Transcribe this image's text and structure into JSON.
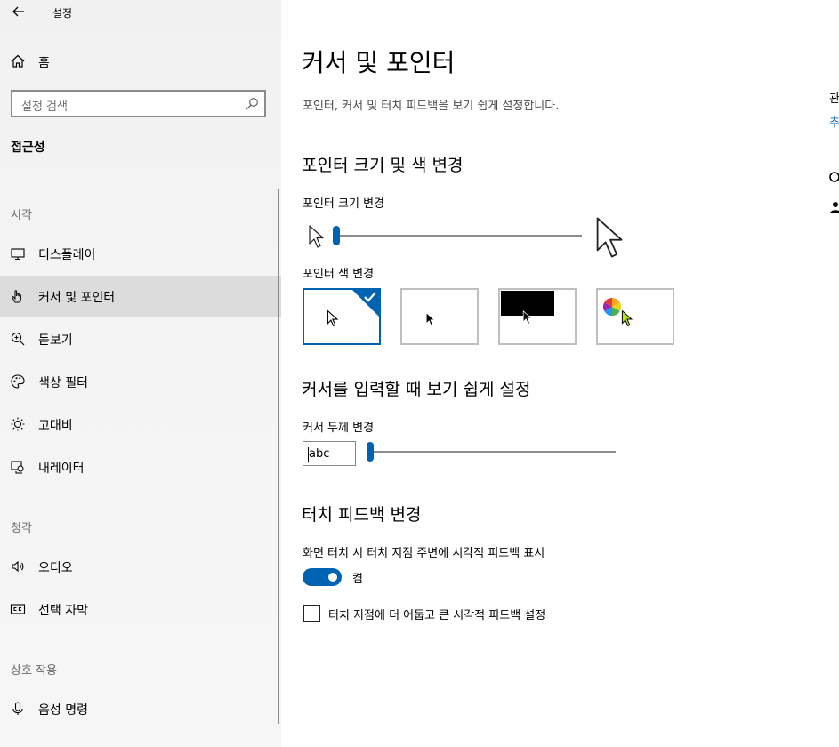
{
  "window": {
    "title": "설정"
  },
  "sidebar": {
    "home_label": "홈",
    "search_placeholder": "설정 검색",
    "section_title": "접근성",
    "groups": [
      {
        "label": "시각",
        "items": [
          {
            "label": "디스플레이",
            "icon": "monitor-icon"
          },
          {
            "label": "커서 및 포인터",
            "icon": "pointer-hand-icon",
            "selected": true
          },
          {
            "label": "돋보기",
            "icon": "magnifier-icon"
          },
          {
            "label": "색상 필터",
            "icon": "palette-icon"
          },
          {
            "label": "고대비",
            "icon": "brightness-icon"
          },
          {
            "label": "내레이터",
            "icon": "narrator-icon"
          }
        ]
      },
      {
        "label": "청각",
        "items": [
          {
            "label": "오디오",
            "icon": "speaker-icon"
          },
          {
            "label": "선택 자막",
            "icon": "cc-icon"
          }
        ]
      },
      {
        "label": "상호 작용",
        "items": [
          {
            "label": "음성 명령",
            "icon": "microphone-icon"
          }
        ]
      }
    ]
  },
  "main": {
    "title": "커서 및 포인터",
    "description": "포인터, 커서 및 터치 피드백을 보기 쉽게 설정합니다.",
    "pointer_section": {
      "heading": "포인터 크기 및 색 변경",
      "size_label": "포인터 크기 변경",
      "size_slider_value": 0.0,
      "color_label": "포인터 색 변경",
      "color_options": [
        {
          "name": "white",
          "selected": true
        },
        {
          "name": "black",
          "selected": false
        },
        {
          "name": "inverted",
          "selected": false
        },
        {
          "name": "custom",
          "selected": false
        }
      ]
    },
    "cursor_section": {
      "heading": "커서를 입력할 때 보기 쉽게 설정",
      "thickness_label": "커서 두께 변경",
      "preview_text": "abc",
      "thickness_slider_value": 0.0
    },
    "touch_section": {
      "heading": "터치 피드백 변경",
      "show_feedback_label": "화면 터치 시 터치 지점 주변에 시각적 피드백 표시",
      "toggle_state": "켬",
      "darker_label": "터치 지점에 더 어둡고 큰 시각적 피드백 설정"
    }
  },
  "right_panel": {
    "fragment_1": "관",
    "fragment_2": "추"
  },
  "colors": {
    "accent": "#0063b1",
    "sidebar_bg": "#f2f2f2",
    "selected_bg": "#dcdcdc"
  }
}
